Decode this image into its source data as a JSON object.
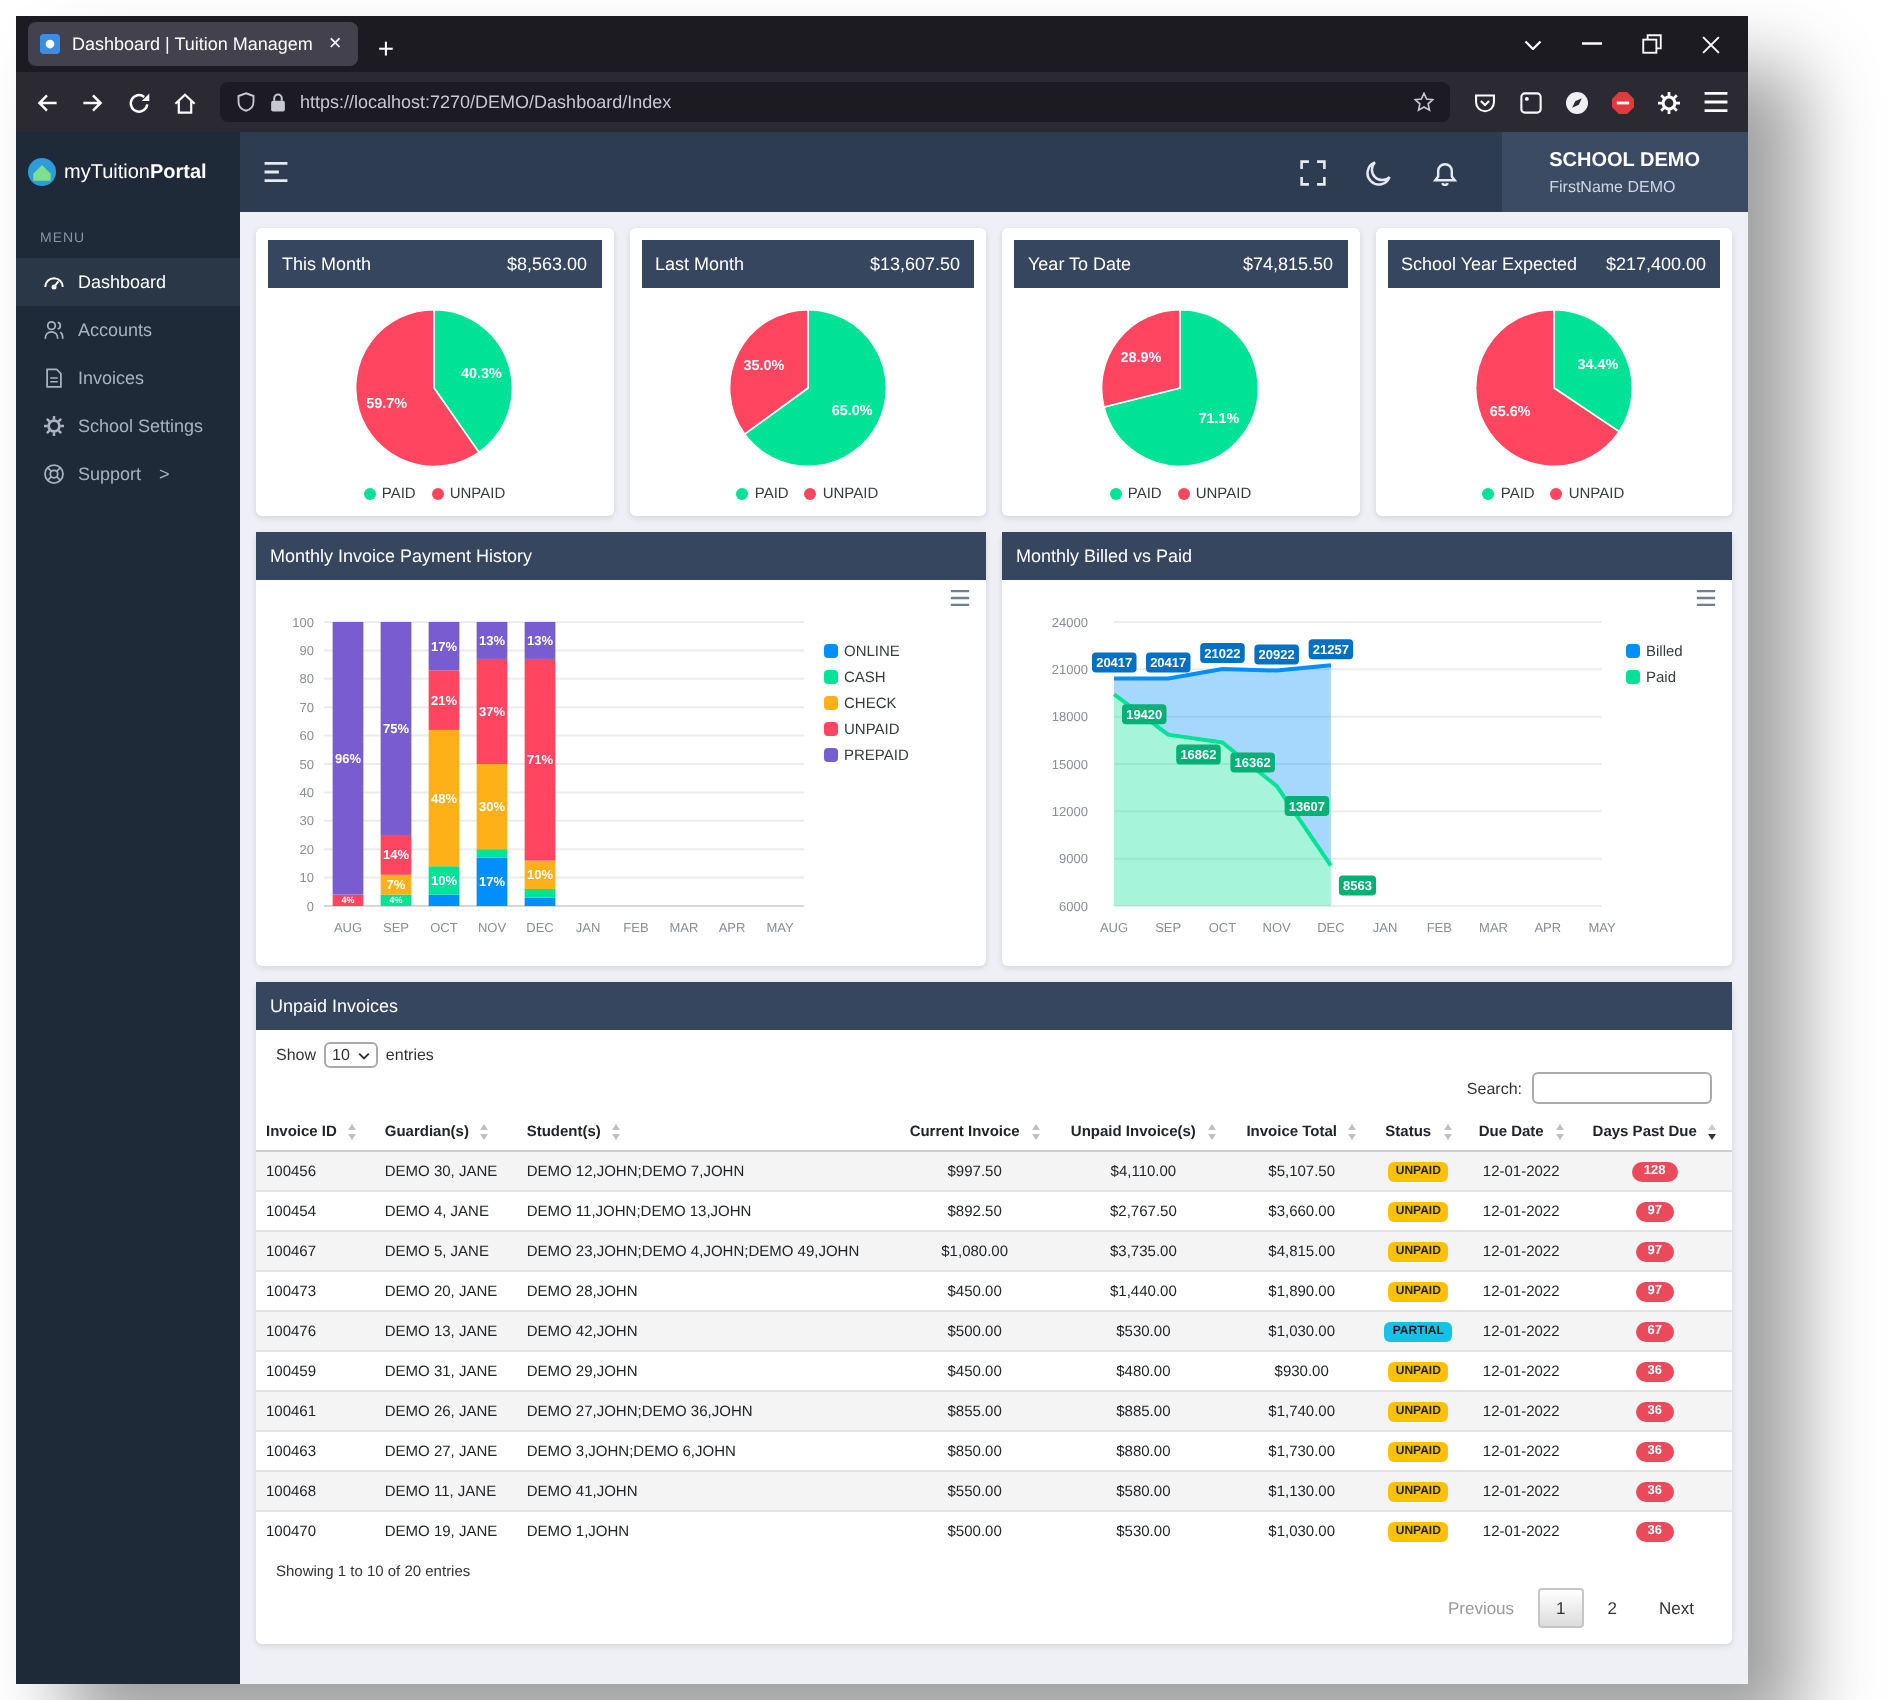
{
  "browser": {
    "tab_title": "Dashboard | Tuition Managem",
    "tab_close": "×",
    "new_tab": "+",
    "url": "https://localhost:7270/DEMO/Dashboard/Index"
  },
  "sidebar": {
    "logo": "myTuition**Portal**",
    "menu_label": "MENU",
    "items": [
      {
        "label": "Dashboard",
        "selected": true
      },
      {
        "label": "Accounts",
        "selected": false
      },
      {
        "label": "Invoices",
        "selected": false
      },
      {
        "label": "School Settings",
        "selected": false
      },
      {
        "label": "Support",
        "caret": ">",
        "selected": false
      }
    ]
  },
  "header": {
    "school": "SCHOOL DEMO",
    "user": "FirstName DEMO"
  },
  "summary_cards": [
    {
      "title": "This Month",
      "amount": "$8,563.00",
      "chart_data": {
        "type": "pie",
        "categories": [
          "PAID",
          "UNPAID"
        ],
        "values": [
          40.3,
          59.7
        ],
        "value_labels": [
          "40.3%",
          "59.7%"
        ],
        "legend": "bottom"
      }
    },
    {
      "title": "Last Month",
      "amount": "$13,607.50",
      "chart_data": {
        "type": "pie",
        "categories": [
          "PAID",
          "UNPAID"
        ],
        "values": [
          65.0,
          35.0
        ],
        "value_labels": [
          "65.0%",
          "35.0%"
        ],
        "legend": "bottom"
      }
    },
    {
      "title": "Year To Date",
      "amount": "$74,815.50",
      "chart_data": {
        "type": "pie",
        "categories": [
          "PAID",
          "UNPAID"
        ],
        "values": [
          71.1,
          28.9
        ],
        "value_labels": [
          "71.1%",
          "28.9%"
        ],
        "legend": "bottom"
      }
    },
    {
      "title": "School Year Expected",
      "amount": "$217,400.00",
      "chart_data": {
        "type": "pie",
        "categories": [
          "PAID",
          "UNPAID"
        ],
        "values": [
          34.4,
          65.6
        ],
        "value_labels": [
          "34.4%",
          "65.6%"
        ],
        "legend": "bottom"
      }
    }
  ],
  "charts": [
    {
      "title": "Monthly Invoice Payment History",
      "chart_data": {
        "type": "bar",
        "stacked": true,
        "categories": [
          "AUG",
          "SEP",
          "OCT",
          "NOV",
          "DEC",
          "JAN",
          "FEB",
          "MAR",
          "APR",
          "MAY"
        ],
        "ylim": [
          0,
          100
        ],
        "yticks": [
          0,
          10,
          20,
          30,
          40,
          50,
          60,
          70,
          80,
          90,
          100
        ],
        "grid": true,
        "legend": "right",
        "series": [
          {
            "name": "ONLINE",
            "color": "#008ffb",
            "values": [
              0,
              0,
              4,
              17,
              3,
              null,
              null,
              null,
              null,
              null
            ]
          },
          {
            "name": "CASH",
            "color": "#00e396",
            "values": [
              0,
              4,
              10,
              3,
              3,
              null,
              null,
              null,
              null,
              null
            ]
          },
          {
            "name": "CHECK",
            "color": "#feb019",
            "values": [
              0,
              7,
              48,
              30,
              10,
              null,
              null,
              null,
              null,
              null
            ]
          },
          {
            "name": "UNPAID",
            "color": "#ff4560",
            "values": [
              4,
              14,
              21,
              37,
              71,
              null,
              null,
              null,
              null,
              null
            ]
          },
          {
            "name": "PREPAID",
            "color": "#775dd0",
            "values": [
              96,
              75,
              17,
              13,
              13,
              null,
              null,
              null,
              null,
              null
            ]
          }
        ],
        "value_labels": [
          [
            null,
            null,
            null,
            "17%",
            null,
            null,
            null,
            null,
            null,
            null
          ],
          [
            null,
            "4%",
            "10%",
            null,
            null,
            null,
            null,
            null,
            null,
            null
          ],
          [
            null,
            "7%",
            "48%",
            "30%",
            "10%",
            null,
            null,
            null,
            null,
            null
          ],
          [
            "4%",
            "14%",
            "21%",
            "37%",
            "71%",
            null,
            null,
            null,
            null,
            null
          ],
          [
            "96%",
            "75%",
            "17%",
            "13%",
            "13%",
            null,
            null,
            null,
            null,
            null
          ]
        ]
      }
    },
    {
      "title": "Monthly Billed vs Paid",
      "chart_data": {
        "type": "area",
        "categories": [
          "AUG",
          "SEP",
          "OCT",
          "NOV",
          "DEC",
          "JAN",
          "FEB",
          "MAR",
          "APR",
          "MAY"
        ],
        "ylim": [
          6000,
          24000
        ],
        "yticks": [
          6000,
          9000,
          12000,
          15000,
          18000,
          21000,
          24000
        ],
        "grid": true,
        "legend": "right",
        "series": [
          {
            "name": "Billed",
            "color": "#008ffb",
            "values": [
              20417,
              20417,
              21022,
              20922,
              21257,
              null,
              null,
              null,
              null,
              null
            ]
          },
          {
            "name": "Paid",
            "color": "#00e396",
            "values": [
              19420,
              16862,
              16362,
              13607,
              8563,
              null,
              null,
              null,
              null,
              null
            ]
          }
        ],
        "value_labels": [
          [
            "20417",
            "20417",
            "21022",
            "20922",
            "21257",
            null,
            null,
            null,
            null,
            null
          ],
          [
            "19420",
            "16862",
            "16362",
            "13607",
            "8563",
            null,
            null,
            null,
            null,
            null
          ]
        ]
      }
    }
  ],
  "unpaid_invoices": {
    "title": "Unpaid Invoices",
    "show_label": "Show",
    "page_length": "10",
    "entries_label": "entries",
    "search_label": "Search:",
    "columns": [
      {
        "label": "Invoice ID",
        "sorted": false
      },
      {
        "label": "Guardian(s)",
        "sorted": false
      },
      {
        "label": "Student(s)",
        "sorted": false
      },
      {
        "label": "Current Invoice",
        "sorted": false
      },
      {
        "label": "Unpaid Invoice(s)",
        "sorted": false
      },
      {
        "label": "Invoice Total",
        "sorted": false
      },
      {
        "label": "Status",
        "sorted": false
      },
      {
        "label": "Due Date",
        "sorted": false
      },
      {
        "label": "Days Past Due",
        "sorted": true
      }
    ],
    "rows": [
      {
        "invoice_id": "100456",
        "guardians": "DEMO 30, JANE",
        "students": "DEMO 12,JOHN;DEMO 7,JOHN",
        "current_invoice": "$997.50",
        "unpaid_invoices": "$4,110.00",
        "invoice_total": "$5,107.50",
        "status": {
          "label": "UNPAID",
          "kind": "unpaid"
        },
        "due_date": "12-01-2022",
        "days_past_due": "128"
      },
      {
        "invoice_id": "100454",
        "guardians": "DEMO 4, JANE",
        "students": "DEMO 11,JOHN;DEMO 13,JOHN",
        "current_invoice": "$892.50",
        "unpaid_invoices": "$2,767.50",
        "invoice_total": "$3,660.00",
        "status": {
          "label": "UNPAID",
          "kind": "unpaid"
        },
        "due_date": "12-01-2022",
        "days_past_due": "97"
      },
      {
        "invoice_id": "100467",
        "guardians": "DEMO 5, JANE",
        "students": "DEMO 23,JOHN;DEMO 4,JOHN;DEMO 49,JOHN",
        "current_invoice": "$1,080.00",
        "unpaid_invoices": "$3,735.00",
        "invoice_total": "$4,815.00",
        "status": {
          "label": "UNPAID",
          "kind": "unpaid"
        },
        "due_date": "12-01-2022",
        "days_past_due": "97"
      },
      {
        "invoice_id": "100473",
        "guardians": "DEMO 20, JANE",
        "students": "DEMO 28,JOHN",
        "current_invoice": "$450.00",
        "unpaid_invoices": "$1,440.00",
        "invoice_total": "$1,890.00",
        "status": {
          "label": "UNPAID",
          "kind": "unpaid"
        },
        "due_date": "12-01-2022",
        "days_past_due": "97"
      },
      {
        "invoice_id": "100476",
        "guardians": "DEMO 13, JANE",
        "students": "DEMO 42,JOHN",
        "current_invoice": "$500.00",
        "unpaid_invoices": "$530.00",
        "invoice_total": "$1,030.00",
        "status": {
          "label": "PARTIAL",
          "kind": "partial"
        },
        "due_date": "12-01-2022",
        "days_past_due": "67"
      },
      {
        "invoice_id": "100459",
        "guardians": "DEMO 31, JANE",
        "students": "DEMO 29,JOHN",
        "current_invoice": "$450.00",
        "unpaid_invoices": "$480.00",
        "invoice_total": "$930.00",
        "status": {
          "label": "UNPAID",
          "kind": "unpaid"
        },
        "due_date": "12-01-2022",
        "days_past_due": "36"
      },
      {
        "invoice_id": "100461",
        "guardians": "DEMO 26, JANE",
        "students": "DEMO 27,JOHN;DEMO 36,JOHN",
        "current_invoice": "$855.00",
        "unpaid_invoices": "$885.00",
        "invoice_total": "$1,740.00",
        "status": {
          "label": "UNPAID",
          "kind": "unpaid"
        },
        "due_date": "12-01-2022",
        "days_past_due": "36"
      },
      {
        "invoice_id": "100463",
        "guardians": "DEMO 27, JANE",
        "students": "DEMO 3,JOHN;DEMO 6,JOHN",
        "current_invoice": "$850.00",
        "unpaid_invoices": "$880.00",
        "invoice_total": "$1,730.00",
        "status": {
          "label": "UNPAID",
          "kind": "unpaid"
        },
        "due_date": "12-01-2022",
        "days_past_due": "36"
      },
      {
        "invoice_id": "100468",
        "guardians": "DEMO 11, JANE",
        "students": "DEMO 41,JOHN",
        "current_invoice": "$550.00",
        "unpaid_invoices": "$580.00",
        "invoice_total": "$1,130.00",
        "status": {
          "label": "UNPAID",
          "kind": "unpaid"
        },
        "due_date": "12-01-2022",
        "days_past_due": "36"
      },
      {
        "invoice_id": "100470",
        "guardians": "DEMO 19, JANE",
        "students": "DEMO 1,JOHN",
        "current_invoice": "$500.00",
        "unpaid_invoices": "$530.00",
        "invoice_total": "$1,030.00",
        "status": {
          "label": "UNPAID",
          "kind": "unpaid"
        },
        "due_date": "12-01-2022",
        "days_past_due": "36"
      }
    ],
    "info": "Showing 1 to 10 of 20 entries",
    "pagination": [
      {
        "label": "Previous",
        "selected": false,
        "disabled": true
      },
      {
        "label": "1",
        "selected": true,
        "disabled": false
      },
      {
        "label": "2",
        "selected": false,
        "disabled": false
      },
      {
        "label": "Next",
        "selected": false,
        "disabled": false
      }
    ]
  }
}
